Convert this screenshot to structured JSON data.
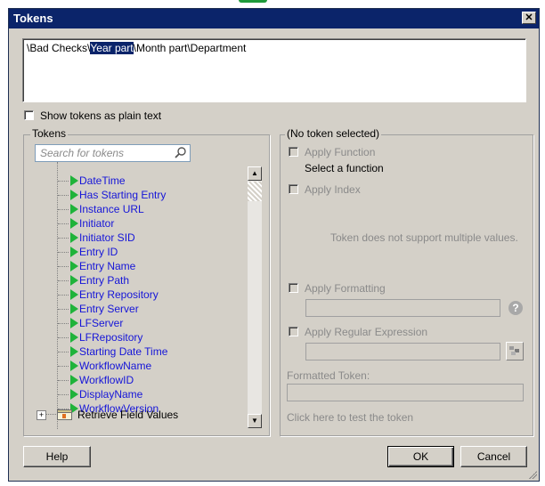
{
  "window": {
    "title": "Tokens",
    "close_symbol": "✕"
  },
  "token_path": {
    "before": "\\Bad Checks\\",
    "selected": "Year part",
    "after": "\\Month part\\Department"
  },
  "plain_text_checkbox": {
    "label": "Show tokens as plain text",
    "checked": false
  },
  "tokens_panel": {
    "legend": "Tokens",
    "search_placeholder": "Search for tokens",
    "items": [
      "DateTime",
      "Has Starting Entry",
      "Instance URL",
      "Initiator",
      "Initiator SID",
      "Entry ID",
      "Entry Name",
      "Entry Path",
      "Entry Repository",
      "Entry Server",
      "LFServer",
      "LFRepository",
      "Starting Date Time",
      "WorkflowName",
      "WorkflowID",
      "DisplayName",
      "WorkflowVersion"
    ],
    "collapsed_node": {
      "expander": "+",
      "label": "Retrieve Field Values"
    }
  },
  "details_panel": {
    "legend": "(No token selected)",
    "apply_function": "Apply Function",
    "select_function": "Select a function",
    "apply_index": "Apply Index",
    "multi_value_note": "Token does not support multiple values.",
    "apply_formatting": "Apply Formatting",
    "apply_regex": "Apply Regular Expression",
    "formatted_token_label": "Formatted Token:",
    "test_link": "Click here to test the token"
  },
  "buttons": {
    "help": "Help",
    "ok": "OK",
    "cancel": "Cancel"
  },
  "colors": {
    "title_bar": "#0b246a",
    "token_text": "#1515d8",
    "token_icon": "#1fb33a",
    "dialog_bg": "#d4d0c8"
  }
}
